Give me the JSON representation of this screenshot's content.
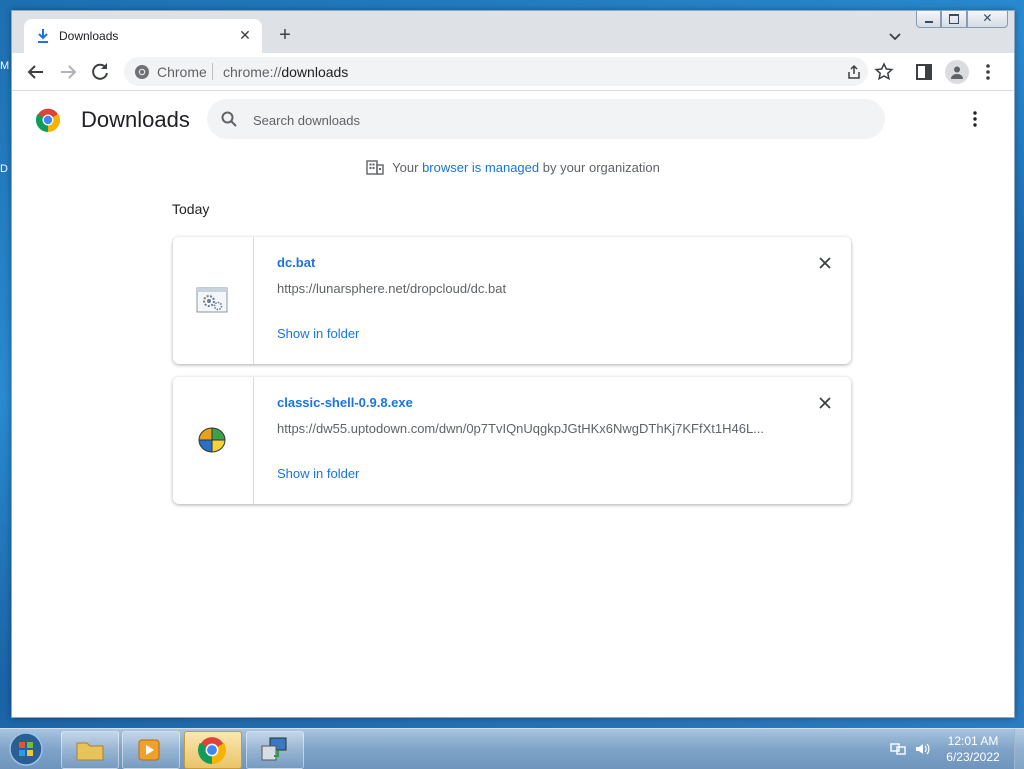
{
  "desktop": {
    "edge_letters": [
      "M",
      "D"
    ]
  },
  "browser": {
    "tab": {
      "title": "Downloads",
      "icon": "download-icon"
    },
    "omnibox": {
      "chip": "Chrome",
      "url_scheme": "chrome://",
      "url_path": "downloads"
    }
  },
  "page": {
    "title": "Downloads",
    "search_placeholder": "Search downloads",
    "managed": {
      "prefix": "Your ",
      "link": "browser is managed",
      "suffix": " by your organization"
    },
    "section_label": "Today",
    "items": [
      {
        "name": "dc.bat",
        "url": "https://lunarsphere.net/dropcloud/dc.bat",
        "action": "Show in folder",
        "icon": "batch-file-icon"
      },
      {
        "name": "classic-shell-0.9.8.exe",
        "url": "https://dw55.uptodown.com/dwn/0p7TvIQnUqgkpJGtHKx6NwgDThKj7KFfXt1H46L...",
        "action": "Show in folder",
        "icon": "classic-shell-icon"
      }
    ]
  },
  "taskbar": {
    "clock_time": "12:01 AM",
    "clock_date": "6/23/2022"
  },
  "colors": {
    "link": "#1a73e8",
    "text": "#202124",
    "muted": "#5f6368"
  }
}
